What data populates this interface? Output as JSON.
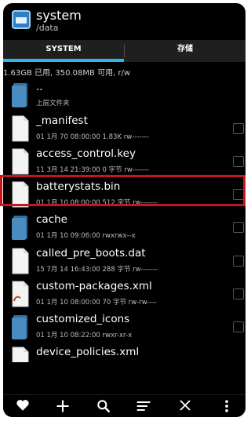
{
  "app": {
    "title": "system",
    "path": "/data"
  },
  "tabs": [
    {
      "label": "SYSTEM",
      "active": true
    },
    {
      "label": "存储",
      "active": false
    }
  ],
  "storage_info": "1.63GB 已用, 350.08MB 可用, r/w",
  "files": [
    {
      "name": "..",
      "meta": "上层文件夹",
      "icon": "folder-icon",
      "checkbox": false
    },
    {
      "name": "_manifest",
      "meta": "01 1月 70 08:00:00  1.83K  rw-------",
      "icon": "file-icon",
      "checkbox": true
    },
    {
      "name": "access_control.key",
      "meta": "11 3月 14 21:39:00  0 字节  rw-------",
      "icon": "file-icon",
      "checkbox": true
    },
    {
      "name": "batterystats.bin",
      "meta": "01 1月 10 08:00:00  512 字节  rw-------",
      "icon": "file-icon",
      "checkbox": true,
      "highlighted": true
    },
    {
      "name": "cache",
      "meta": "01 1月 10 09:06:00     rwxrwx--x",
      "icon": "folder-icon",
      "checkbox": true
    },
    {
      "name": "called_pre_boots.dat",
      "meta": "15 7月 14 16:43:00  288 字节  rw-------",
      "icon": "file-icon",
      "checkbox": true
    },
    {
      "name": "custom-packages.xml",
      "meta": "01 1月 10 08:00:00  70 字节  rw-rw----",
      "icon": "xml-file-icon",
      "checkbox": true
    },
    {
      "name": "customized_icons",
      "meta": "01 1月 10 08:22:00     rwxr-xr-x",
      "icon": "folder-icon",
      "checkbox": true
    },
    {
      "name": "device_policies.xml",
      "meta": "",
      "icon": "file-icon",
      "checkbox": false
    }
  ],
  "bottom_bar": [
    "heart-icon",
    "plus-icon",
    "search-icon",
    "sort-icon",
    "close-icon",
    "more-icon"
  ],
  "colors": {
    "accent": "#33b5e5",
    "highlight": "#c4161c",
    "background": "#000000",
    "folder": "#3f7fb0"
  }
}
